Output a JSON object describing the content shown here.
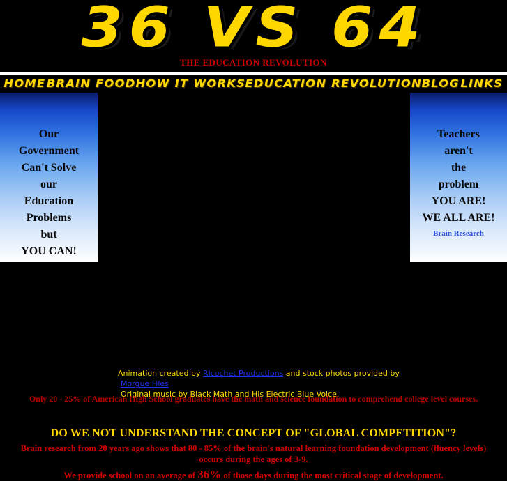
{
  "site": {
    "logo_text": "36 VS 64",
    "subtitle": "THE EDUCATION REVOLUTION"
  },
  "nav": {
    "items": [
      {
        "label": "HOME",
        "name": "nav-item-home"
      },
      {
        "label": "BRAIN FOOD",
        "name": "nav-item-brain-food"
      },
      {
        "label": "HOW IT WORKS",
        "name": "nav-item-how-it-works"
      },
      {
        "label": "EDUCATION REVOLUTION",
        "name": "nav-item-education-revolution"
      },
      {
        "label": "BLOG",
        "name": "nav-item-blog"
      },
      {
        "label": "LINKS",
        "name": "nav-item-links"
      }
    ]
  },
  "left_panel": {
    "lines": [
      "Our",
      "Government",
      "Can't Solve",
      "our",
      "Education",
      "Problems",
      "but",
      "YOU CAN!"
    ]
  },
  "right_panel": {
    "lines": [
      "Teachers",
      "aren't",
      "the",
      "problem",
      "YOU ARE!",
      "WE ALL ARE!"
    ],
    "link_label": "Brain Research"
  },
  "credits": {
    "line1_prefix": "Animation created by ",
    "line1_link": "Ricochet Productions",
    "line1_middle": " and stock photos provided by",
    "line2_link": "Morgue Files",
    "line3": "Original music by Black Math and His Electric Blue Voice."
  },
  "red_band": {
    "text": "Only 20 - 25% of American High School graduates have the math and science foundation to comprehend college level courses."
  },
  "bottom": {
    "heading": "DO WE NOT UNDERSTAND THE CONCEPT OF \"GLOBAL COMPETITION\"?",
    "paragraph1": "Brain research from 20 years ago shows that 80 - 85% of the brain's natural learning foundation development (fluency levels) occurs during the ages of 3-9.",
    "paragraph2_prefix": "We provide school on an average of ",
    "paragraph2_pct": "36%",
    "paragraph2_suffix": " of those days during the most critical stage of development."
  },
  "colors": {
    "background": "#000000",
    "accent_yellow": "#FFD700",
    "accent_red": "#CC0000",
    "link_blue": "#2233EE",
    "panel_blue_top": "#0b1b6b",
    "panel_blue_bottom": "#ffffff"
  }
}
